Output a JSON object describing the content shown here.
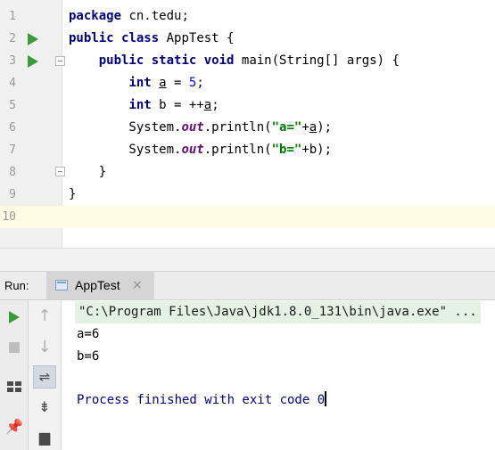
{
  "editor": {
    "lines": [
      {
        "n": "1",
        "tokens": [
          {
            "t": "package",
            "c": "kw"
          },
          {
            "t": " cn.tedu;",
            "c": ""
          }
        ]
      },
      {
        "n": "2",
        "tokens": [
          {
            "t": "public",
            "c": "kw"
          },
          {
            "t": " ",
            "c": ""
          },
          {
            "t": "class",
            "c": "kw"
          },
          {
            "t": " AppTest {",
            "c": ""
          }
        ]
      },
      {
        "n": "3",
        "tokens": [
          {
            "t": "    ",
            "c": ""
          },
          {
            "t": "public",
            "c": "kw"
          },
          {
            "t": " ",
            "c": ""
          },
          {
            "t": "static",
            "c": "kw"
          },
          {
            "t": " ",
            "c": ""
          },
          {
            "t": "void",
            "c": "kw"
          },
          {
            "t": " main(String[] args) {",
            "c": ""
          }
        ]
      },
      {
        "n": "4",
        "tokens": [
          {
            "t": "        ",
            "c": ""
          },
          {
            "t": "int",
            "c": "kw"
          },
          {
            "t": " ",
            "c": ""
          },
          {
            "t": "a",
            "c": "var-ul"
          },
          {
            "t": " = ",
            "c": ""
          },
          {
            "t": "5",
            "c": "num"
          },
          {
            "t": ";",
            "c": ""
          }
        ]
      },
      {
        "n": "5",
        "tokens": [
          {
            "t": "        ",
            "c": ""
          },
          {
            "t": "int",
            "c": "kw"
          },
          {
            "t": " b = ++",
            "c": ""
          },
          {
            "t": "a",
            "c": "var-ul"
          },
          {
            "t": ";",
            "c": ""
          }
        ]
      },
      {
        "n": "6",
        "tokens": [
          {
            "t": "        System.",
            "c": ""
          },
          {
            "t": "out",
            "c": "fld"
          },
          {
            "t": ".println(",
            "c": ""
          },
          {
            "t": "\"a=\"",
            "c": "str"
          },
          {
            "t": "+",
            "c": ""
          },
          {
            "t": "a",
            "c": "var-ul"
          },
          {
            "t": ");",
            "c": ""
          }
        ]
      },
      {
        "n": "7",
        "tokens": [
          {
            "t": "        System.",
            "c": ""
          },
          {
            "t": "out",
            "c": "fld"
          },
          {
            "t": ".println(",
            "c": ""
          },
          {
            "t": "\"b=\"",
            "c": "str"
          },
          {
            "t": "+b);",
            "c": ""
          }
        ]
      },
      {
        "n": "8",
        "tokens": [
          {
            "t": "    }",
            "c": ""
          }
        ]
      },
      {
        "n": "9",
        "tokens": [
          {
            "t": "}",
            "c": ""
          }
        ]
      },
      {
        "n": "10",
        "tokens": []
      }
    ],
    "run_markers_on_lines": [
      "2",
      "3"
    ],
    "current_line": "10"
  },
  "run_panel": {
    "label": "Run:",
    "tab_label": "AppTest",
    "tab_close_glyph": "×",
    "icons": {
      "run": "play-icon",
      "stop": "stop-icon",
      "layout": "layout-icon",
      "pin": "pin-icon",
      "scroll_up": "arrow-up-icon",
      "scroll_down": "arrow-down-icon",
      "soft_wrap": "soft-wrap-icon",
      "scroll_to_end": "scroll-to-end-icon",
      "print": "print-icon"
    },
    "glyphs": {
      "pin": "📌",
      "up": "↑",
      "down": "↓",
      "wrap": "⇌",
      "scroll_end": "⇟",
      "print": "▆"
    }
  },
  "console": {
    "command": "\"C:\\Program Files\\Java\\jdk1.8.0_131\\bin\\java.exe\" ...",
    "output": [
      "a=6",
      "b=6"
    ],
    "exit_message": "Process finished with exit code 0"
  },
  "colors": {
    "keyword": "#000080",
    "number": "#0000ff",
    "string": "#008000",
    "static_field": "#660e7a",
    "run_green": "#3a9b3a",
    "current_line": "#fefbe5"
  }
}
